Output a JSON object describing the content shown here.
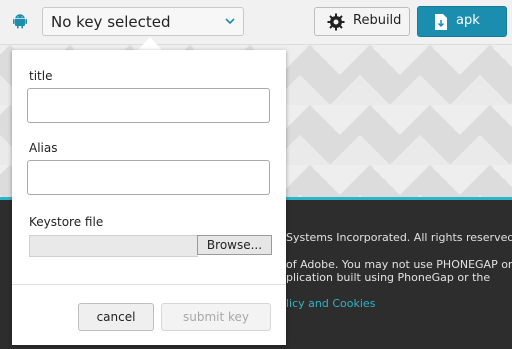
{
  "toolbar": {
    "platform_icon": "android-icon",
    "key_select_value": "No key selected",
    "rebuild_label": "Rebuild",
    "apk_label": "apk",
    "apk_color": "#1b8eb0"
  },
  "dialog": {
    "title_label": "title",
    "title_value": "",
    "alias_label": "Alias",
    "alias_value": "",
    "keystore_label": "Keystore file",
    "browse_label": "Browse...",
    "cancel_label": "cancel",
    "submit_label": "submit key"
  },
  "footer": {
    "line1": "Systems Incorporated. All rights reserved.",
    "line2": "of Adobe. You may not use PHONEGAP or",
    "line3": "plication built using PhoneGap or the",
    "link": "licy and Cookies",
    "accent_color": "#2bb5c6"
  }
}
